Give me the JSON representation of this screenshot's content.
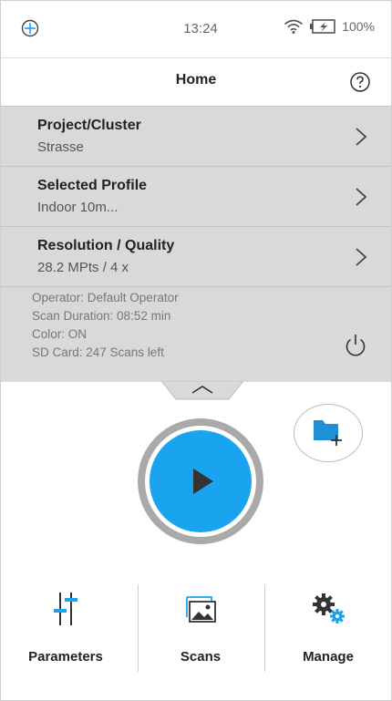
{
  "status_bar": {
    "time": "13:24",
    "battery_percent": "100%",
    "icons": [
      "crosshair-logo-icon",
      "wifi-icon",
      "battery-charging-icon"
    ]
  },
  "header": {
    "title": "Home",
    "help_icon": "help-icon"
  },
  "settings": [
    {
      "title": "Project/Cluster",
      "value": "Strasse"
    },
    {
      "title": "Selected Profile",
      "value": "Indoor 10m..."
    },
    {
      "title": "Resolution / Quality",
      "value": "28.2 MPts / 4 x"
    }
  ],
  "info": {
    "operator": "Operator: Default Operator",
    "scan_duration": "Scan Duration: 08:52 min",
    "color": "Color: ON",
    "sd_card": "SD Card: 247 Scans left"
  },
  "nav": [
    {
      "label": "Parameters",
      "icon": "sliders-icon"
    },
    {
      "label": "Scans",
      "icon": "image-gallery-icon"
    },
    {
      "label": "Manage",
      "icon": "gears-icon"
    }
  ],
  "colors": {
    "accent": "#1aa3ee",
    "panel_bg": "#d9d9d9",
    "ring": "#a9a9a9"
  }
}
